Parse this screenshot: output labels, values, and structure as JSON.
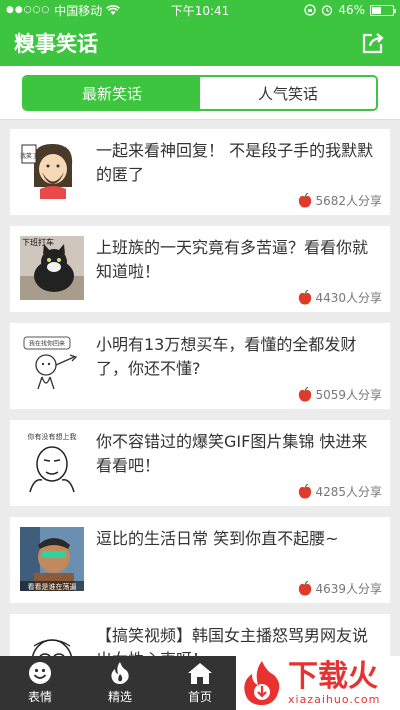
{
  "status_bar": {
    "carrier": "中国移动",
    "time": "下午10:41",
    "battery": "46%",
    "battery_level": 0.46
  },
  "nav": {
    "title": "糗事笑话"
  },
  "tabs": [
    {
      "label": "最新笑话",
      "active": true
    },
    {
      "label": "人气笑话",
      "active": false
    }
  ],
  "posts": [
    {
      "text": "一起来看神回复！ 不是段子手的我默默的匿了",
      "shares": "5682人分享",
      "thumb_caption": "我笑了"
    },
    {
      "text": "上班族的一天究竟有多苦逼？看看你就知道啦！",
      "shares": "4430人分享",
      "thumb_caption": "下班打车"
    },
    {
      "text": "小明有13万想买车，看懂的全都发财了，你还不懂?",
      "shares": "5059人分享",
      "thumb_caption": "我在找你回来"
    },
    {
      "text": "你不容错过的爆笑GIF图片集锦 快进来看看吧！",
      "shares": "4285人分享",
      "thumb_caption": "你有没有想上我"
    },
    {
      "text": "逗比的生活日常 笑到你直不起腰~",
      "shares": "4639人分享",
      "thumb_caption": "看看是谁在荡逼"
    },
    {
      "text": "【搞笑视频】韩国女主播怒骂男网友说出女性心声呀！",
      "shares": "",
      "thumb_caption": ""
    }
  ],
  "tabbar": [
    {
      "label": "表情",
      "icon": "smiley-icon"
    },
    {
      "label": "精选",
      "icon": "flame-icon"
    },
    {
      "label": "首页",
      "icon": "home-icon"
    }
  ],
  "watermark": {
    "big": "下载火",
    "small": "xiazaihuo.com"
  },
  "colors": {
    "accent": "#3ec53f",
    "tabbar": "#333333",
    "watermark": "#e8322f"
  }
}
